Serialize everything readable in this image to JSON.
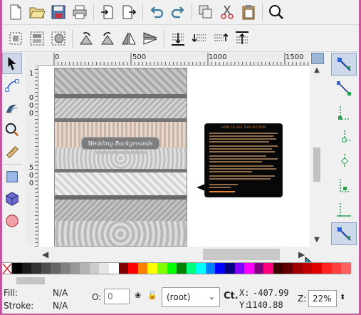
{
  "toolbar_primary": [
    {
      "name": "new-document-icon"
    },
    {
      "name": "open-icon"
    },
    {
      "name": "save-icon"
    },
    {
      "name": "print-icon"
    },
    {
      "name": "import-icon"
    },
    {
      "name": "export-icon"
    },
    {
      "name": "undo-icon"
    },
    {
      "name": "redo-icon"
    },
    {
      "name": "duplicate-icon"
    },
    {
      "name": "cut-icon"
    },
    {
      "name": "paste-icon"
    },
    {
      "name": "zoom-icon"
    }
  ],
  "toolbar_secondary": [
    {
      "name": "select-all-icon"
    },
    {
      "name": "select-all-layers-icon"
    },
    {
      "name": "deselect-icon"
    },
    {
      "name": "rotate-ccw-icon"
    },
    {
      "name": "rotate-cw-icon"
    },
    {
      "name": "flip-horizontal-icon"
    },
    {
      "name": "flip-vertical-icon"
    },
    {
      "name": "lower-to-bottom-icon"
    },
    {
      "name": "lower-icon"
    },
    {
      "name": "raise-icon"
    },
    {
      "name": "raise-to-top-icon"
    }
  ],
  "tools": [
    {
      "name": "selector-tool-icon",
      "active": true
    },
    {
      "name": "node-tool-icon",
      "active": false
    },
    {
      "name": "tweak-tool-icon",
      "active": false
    },
    {
      "name": "zoom-tool-icon",
      "active": false
    },
    {
      "name": "measure-tool-icon",
      "active": false
    },
    {
      "name": "rectangle-tool-icon",
      "active": false
    },
    {
      "name": "box3d-tool-icon",
      "active": false
    },
    {
      "name": "ellipse-tool-icon",
      "active": false
    }
  ],
  "ruler": {
    "h_ticks": [
      "0",
      "500",
      "1000",
      "1500"
    ],
    "v_ticks": [
      "1",
      "0",
      "0",
      "0",
      "5",
      "0",
      "0"
    ]
  },
  "canvas": {
    "page_badge_title": "Wedding Backgrounds",
    "note_title": "HOW TO USE THIS VECTOR?"
  },
  "palette": [
    "#000000",
    "#1a1a1a",
    "#333333",
    "#4d4d4d",
    "#666666",
    "#808080",
    "#999999",
    "#b3b3b3",
    "#cccccc",
    "#e6e6e6",
    "#ffffff",
    "#800000",
    "#ff0000",
    "#ff8000",
    "#ffff00",
    "#80ff00",
    "#00ff00",
    "#008000",
    "#00ff80",
    "#00ffff",
    "#0080ff",
    "#0000ff",
    "#000080",
    "#8000ff",
    "#ff00ff",
    "#800080",
    "#ff0080",
    "#400000",
    "#600000",
    "#a00000",
    "#c00000",
    "#e00000",
    "#ff2020",
    "#ff4040",
    "#ff6060"
  ],
  "status": {
    "fill_label": "Fill:",
    "fill_value": "N/A",
    "stroke_label": "Stroke:",
    "stroke_value": "N/A",
    "opacity_label": "O:",
    "opacity_value": "0",
    "layer": "(root)",
    "cursor_tool_label": "Ct.",
    "x_label": "X:",
    "x_value": "-407.99",
    "y_label": "Y:",
    "y_value": "1140.88",
    "zoom_label": "Z:",
    "zoom_value": "22%"
  }
}
